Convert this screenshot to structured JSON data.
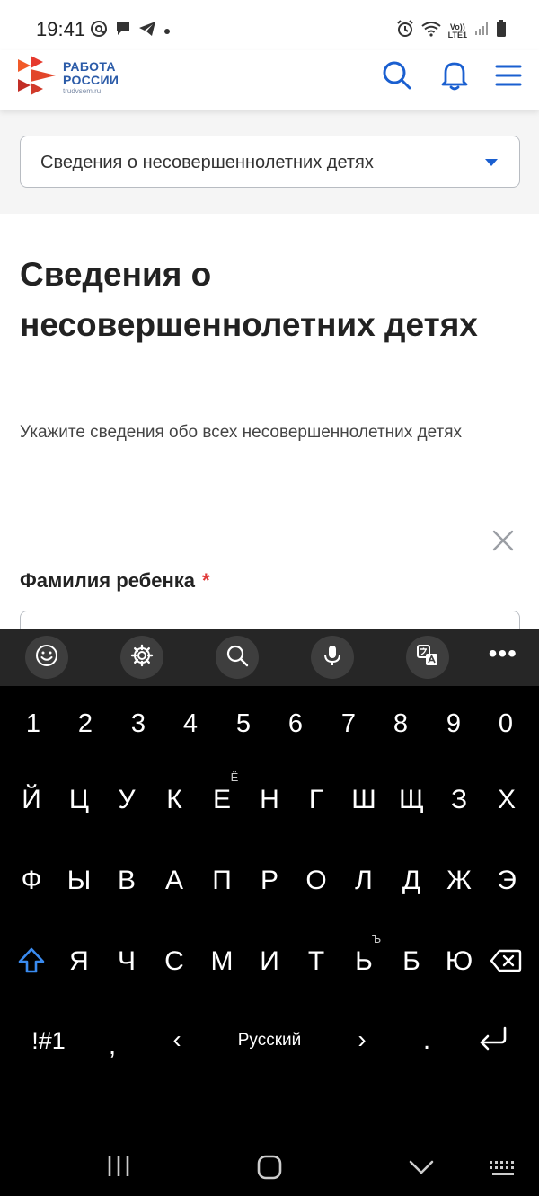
{
  "status_bar": {
    "time": "19:41",
    "network_label_top": "Vo))",
    "network_label_bottom": "LTE1"
  },
  "header": {
    "logo_line1": "РАБОТА",
    "logo_line2": "РОССИИ",
    "logo_sub": "trudvsem.ru",
    "logo_colors": [
      "#F15A29",
      "#E63A2E",
      "#C22E26"
    ],
    "brand_color": "#2B5BA8"
  },
  "section_select": {
    "value": "Сведения о несовершеннолетних детях"
  },
  "page": {
    "title": "Сведения о несовершеннолетних детях",
    "description": "Укажите сведения обо всех несовершеннолетних детях",
    "field_label": "Фамилия ребенка",
    "required_mark": "*",
    "field_value": ""
  },
  "keyboard": {
    "numbers": [
      "1",
      "2",
      "3",
      "4",
      "5",
      "6",
      "7",
      "8",
      "9",
      "0"
    ],
    "row1": [
      "Й",
      "Ц",
      "У",
      "К",
      "Е",
      "Н",
      "Г",
      "Ш",
      "Щ",
      "З",
      "Х"
    ],
    "row1_hint": "Ё",
    "row2": [
      "Ф",
      "Ы",
      "В",
      "А",
      "П",
      "Р",
      "О",
      "Л",
      "Д",
      "Ж",
      "Э"
    ],
    "row3": [
      "Я",
      "Ч",
      "С",
      "М",
      "И",
      "Т",
      "Ь",
      "Б",
      "Ю"
    ],
    "row3_hint": "Ъ",
    "symbols_label": "!#1",
    "comma": ",",
    "lang_left": "‹",
    "language": "Русский",
    "lang_right": "›",
    "period": "."
  }
}
